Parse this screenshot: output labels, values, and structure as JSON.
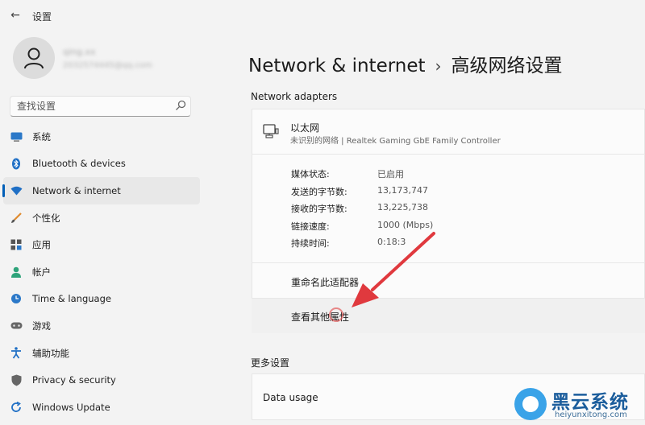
{
  "app": {
    "title": "设置"
  },
  "account": {
    "name": "qing.xx",
    "email": "2032574445@qq.com"
  },
  "search": {
    "placeholder": "查找设置"
  },
  "sidebar": {
    "items": [
      {
        "label": "系统",
        "icon": "monitor-icon",
        "active": false
      },
      {
        "label": "Bluetooth & devices",
        "icon": "bluetooth-icon",
        "active": false
      },
      {
        "label": "Network & internet",
        "icon": "wifi-icon",
        "active": true
      },
      {
        "label": "个性化",
        "icon": "brush-icon",
        "active": false
      },
      {
        "label": "应用",
        "icon": "apps-icon",
        "active": false
      },
      {
        "label": "帐户",
        "icon": "person-icon",
        "active": false
      },
      {
        "label": "Time & language",
        "icon": "globe-clock-icon",
        "active": false
      },
      {
        "label": "游戏",
        "icon": "gamepad-icon",
        "active": false
      },
      {
        "label": "辅助功能",
        "icon": "accessibility-icon",
        "active": false
      },
      {
        "label": "Privacy & security",
        "icon": "shield-icon",
        "active": false
      },
      {
        "label": "Windows Update",
        "icon": "update-icon",
        "active": false
      }
    ]
  },
  "breadcrumb": {
    "parent": "Network & internet",
    "separator": "›",
    "current": "高级网络设置"
  },
  "adapters": {
    "section_label": "Network adapters",
    "adapter": {
      "name": "以太网",
      "description": "未识别的网络 | Realtek Gaming GbE Family Controller",
      "properties": [
        {
          "key": "媒体状态:",
          "value": "已启用"
        },
        {
          "key": "发送的字节数:",
          "value": "13,173,747"
        },
        {
          "key": "接收的字节数:",
          "value": "13,225,738"
        },
        {
          "key": "链接速度:",
          "value": "1000 (Mbps)"
        },
        {
          "key": "持续时间:",
          "value": "0:18:3"
        }
      ],
      "actions": {
        "rename": "重命名此适配器",
        "view_properties": "查看其他属性"
      }
    }
  },
  "more_settings": {
    "section_label": "更多设置",
    "data_usage": "Data usage"
  },
  "watermark": {
    "title": "黑云系统",
    "url": "heiyunxitong.com"
  },
  "colors": {
    "accent": "#005fb8",
    "arrow": "#e0393e",
    "watermark": "#1b5d9c"
  }
}
